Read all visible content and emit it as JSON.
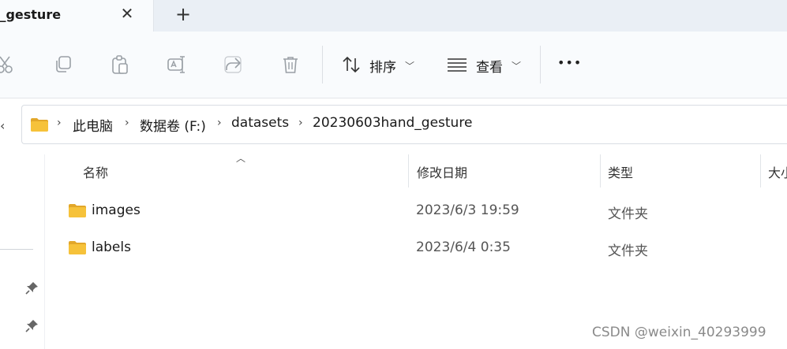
{
  "tab": {
    "title": "d_gesture",
    "close_glyph": "✕",
    "new_tab_glyph": "+"
  },
  "toolbar": {
    "icons": [
      "cut-icon",
      "copy-icon",
      "paste-icon",
      "rename-icon",
      "share-icon",
      "delete-icon"
    ],
    "sort_label": "排序",
    "view_label": "查看",
    "more_glyph": "•••"
  },
  "address": {
    "crumbs": [
      "此电脑",
      "数据卷 (F:)",
      "datasets",
      "20230603hand_gesture"
    ]
  },
  "columns": {
    "name": "名称",
    "date": "修改日期",
    "type": "类型",
    "size": "大小"
  },
  "files": [
    {
      "name": "images",
      "date": "2023/6/3 19:59",
      "type": "文件夹"
    },
    {
      "name": "labels",
      "date": "2023/6/4 0:35",
      "type": "文件夹"
    }
  ],
  "watermark": "CSDN @weixin_40293999",
  "colors": {
    "folder": "#f6c23a",
    "folder_dark": "#e2a72a"
  }
}
